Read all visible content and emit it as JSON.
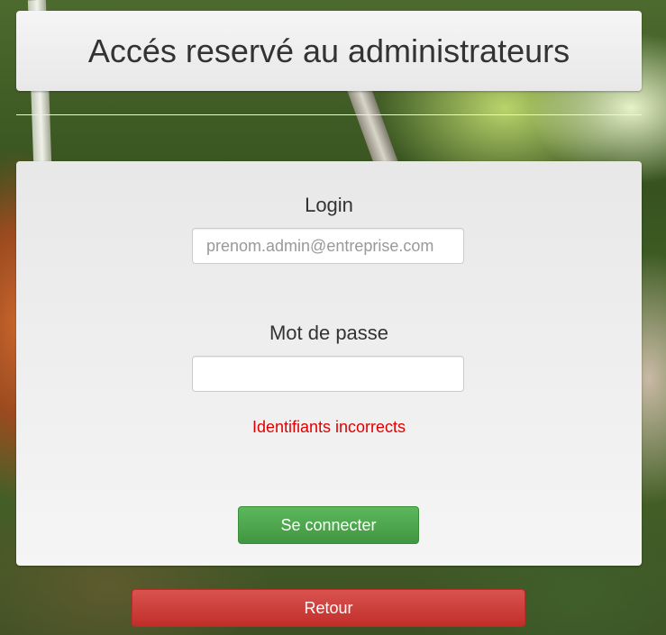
{
  "header": {
    "title": "Accés reservé au administrateurs"
  },
  "form": {
    "login_label": "Login",
    "login_value": "",
    "login_placeholder": "prenom.admin@entreprise.com",
    "password_label": "Mot de passe",
    "password_value": "",
    "error_message": "Identifiants incorrects",
    "submit_label": "Se connecter"
  },
  "back_label": "Retour",
  "colors": {
    "success": "#5cb85c",
    "danger": "#d9534f",
    "error_text": "#e00000"
  }
}
